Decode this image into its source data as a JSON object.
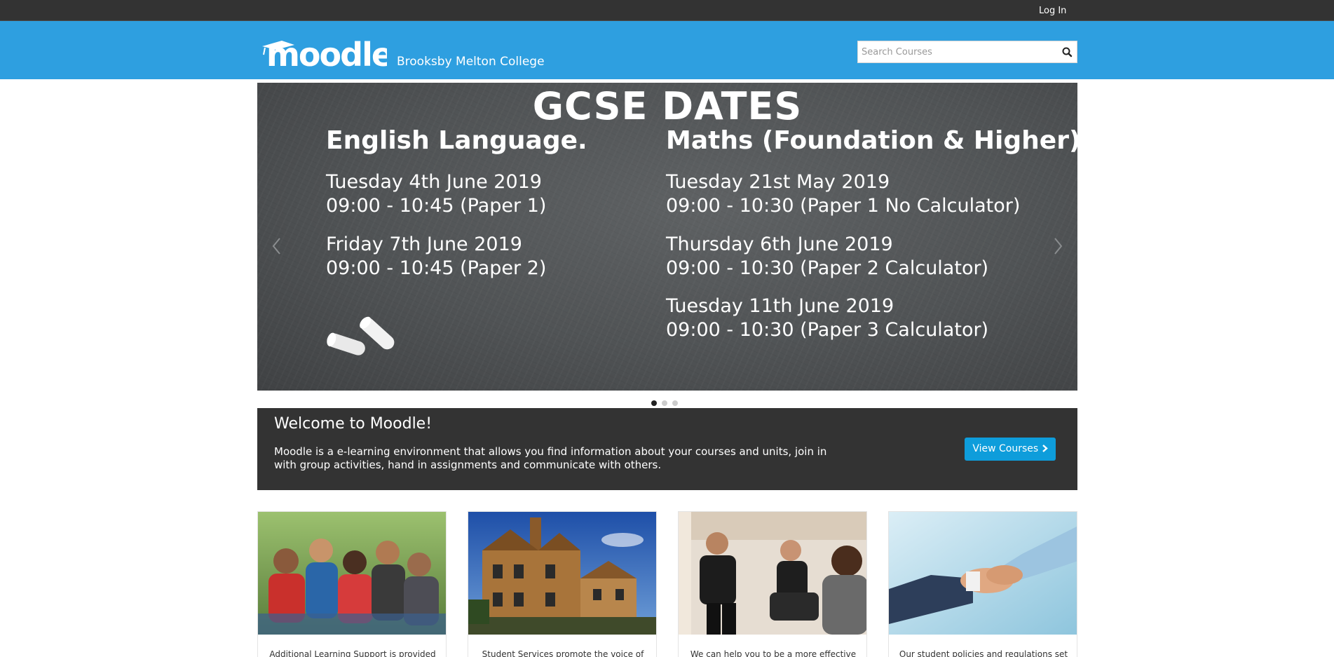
{
  "topbar": {
    "login_label": "Log In"
  },
  "header": {
    "logo_text": "moodle",
    "site_name": "Brooksby Melton College",
    "search_placeholder": "Search Courses"
  },
  "slider": {
    "title": "GCSE DATES",
    "left_column": {
      "heading": "English Language.",
      "entries": [
        {
          "date": "Tuesday 4th June 2019",
          "time": "09:00 - 10:45 (Paper 1)"
        },
        {
          "date": "Friday 7th June 2019",
          "time": "09:00 - 10:45 (Paper 2)"
        }
      ]
    },
    "right_column": {
      "heading": "Maths (Foundation & Higher).",
      "entries": [
        {
          "date": "Tuesday 21st May 2019",
          "time": "09:00 - 10:30 (Paper 1 No Calculator)"
        },
        {
          "date": "Thursday 6th June 2019",
          "time": "09:00 - 10:30 (Paper 2 Calculator)"
        },
        {
          "date": "Tuesday 11th June 2019",
          "time": "09:00 - 10:30 (Paper 3 Calculator)"
        }
      ]
    },
    "slide_count": 3,
    "active_slide": 1
  },
  "welcome": {
    "title": "Welcome to Moodle!",
    "text": "Moodle is a e-learning environment that allows you find information about your courses and units, join in with group activities, hand in assignments and communicate with others.",
    "button_label": "View Courses"
  },
  "cards": [
    {
      "caption": "Additional Learning Support is provided",
      "image": "group-of-students-photo"
    },
    {
      "caption": "Student Services promote the voice of",
      "image": "college-building-photo"
    },
    {
      "caption": "We can help you to be a more effective",
      "image": "meeting-photo"
    },
    {
      "caption": "Our student policies and regulations set",
      "image": "handshake-photo"
    }
  ],
  "colors": {
    "topbar": "#333333",
    "header": "#2e9fe0",
    "welcome_bg": "#333333",
    "button": "#0e9ddb"
  }
}
